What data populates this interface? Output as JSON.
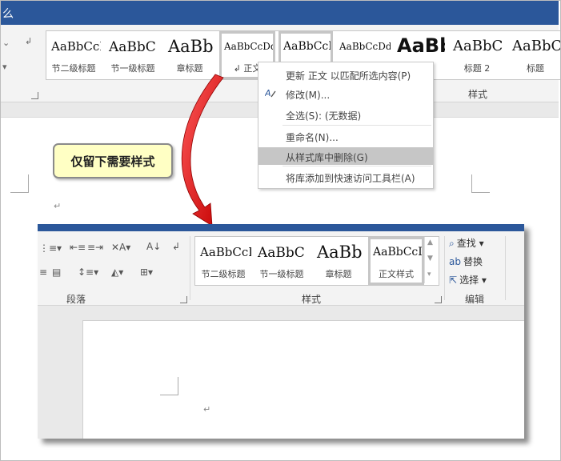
{
  "window": {
    "title_fragment": "么"
  },
  "gallery_top": [
    {
      "preview": "AaBbCcDd",
      "caption": "节二级标题",
      "size": 15
    },
    {
      "preview": "AaBbC",
      "caption": "节一级标题",
      "size": 17
    },
    {
      "preview": "AaBb",
      "caption": "章标题",
      "size": 21
    },
    {
      "preview": "AaBbCcDd",
      "caption": "↲ 正文",
      "size": 12,
      "selected": true
    },
    {
      "preview": "AaBbCcI",
      "caption": "",
      "size": 14,
      "selected": true
    },
    {
      "preview": "AaBbCcDd",
      "caption": "",
      "size": 12
    },
    {
      "preview": "AaBb",
      "caption": "",
      "size": 24,
      "bold": true
    },
    {
      "preview": "AaBbC",
      "caption": "标题 2",
      "size": 18
    },
    {
      "preview": "AaBbC",
      "caption": "标题",
      "size": 18
    }
  ],
  "group_top": {
    "styles_label": "样式"
  },
  "context_menu": {
    "items": [
      {
        "label": "更新 正文 以匹配所选内容(P)",
        "icon": ""
      },
      {
        "label": "修改(M)...",
        "icon": "modify-icon"
      },
      {
        "label": "全选(S): (无数据)",
        "icon": ""
      },
      {
        "label": "重命名(N)...",
        "icon": ""
      },
      {
        "label": "从样式库中删除(G)",
        "icon": "",
        "highlighted": true
      },
      {
        "label": "将库添加到快速访问工具栏(A)",
        "icon": ""
      }
    ]
  },
  "callout": {
    "text": "仅留下需要样式"
  },
  "lower": {
    "gallery": [
      {
        "preview": "AaBbCcDd",
        "caption": "节二级标题",
        "size": 15
      },
      {
        "preview": "AaBbC",
        "caption": "节一级标题",
        "size": 17
      },
      {
        "preview": "AaBb",
        "caption": "章标题",
        "size": 21
      },
      {
        "preview": "AaBbCcI",
        "caption": "正文样式",
        "size": 14,
        "selected": true
      }
    ],
    "groups": {
      "paragraph": "段落",
      "styles": "样式",
      "editing": "编辑"
    },
    "editing": {
      "find": "查找",
      "replace": "替换",
      "select": "选择"
    }
  },
  "colors": {
    "titlebar": "#2b579a",
    "callout_fill": "#ffffc4",
    "arrow": "#e00000",
    "menu_highlight": "#c6c6c6"
  }
}
